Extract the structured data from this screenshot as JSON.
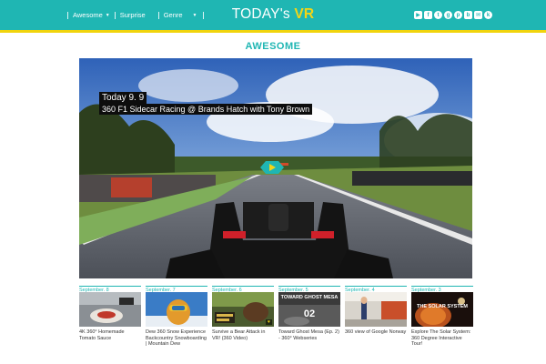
{
  "header": {
    "nav": [
      {
        "label": "Awesome",
        "dropdown": true
      },
      {
        "label": "Surprise",
        "dropdown": false
      },
      {
        "label": "Genre",
        "dropdown": true
      }
    ],
    "brand_part1": "TODAY's",
    "brand_part2": "VR",
    "socials": [
      "youtube-icon",
      "facebook-icon",
      "twitter-icon",
      "google-plus-icon",
      "pinterest-icon",
      "blog-icon",
      "mail-icon",
      "kakao-icon"
    ],
    "colors": {
      "bar": "#1fb6b3",
      "stripe": "#f1d40d",
      "accent": "#f3d516"
    }
  },
  "section": {
    "title": "AWESOME"
  },
  "featured": {
    "date": "Today 9. 9",
    "title": "360 F1 Sidecar Racing @ Brands Hatch with Tony Brown"
  },
  "thumbnails": [
    {
      "date": "September. 8",
      "caption": "4K 360° Homemade Tomato Sauce"
    },
    {
      "date": "September. 7",
      "caption": "Dew 360 Snow Experience Backcountry Snowboarding | Mountain Dew"
    },
    {
      "date": "September. 6",
      "caption": "Survive a Bear Attack in VR! (360 Video)"
    },
    {
      "date": "September. 5",
      "caption": "Toward Ghost Mesa (Ep. 2) - 360° Webseries",
      "overlay": "TOWARD GHOST MESA",
      "overlay_num": "02"
    },
    {
      "date": "September. 4",
      "caption": "360 view of Google Norway"
    },
    {
      "date": "September. 3",
      "caption": "Explore The Solar System: 360 Degree Interactive Tour!",
      "overlay": "THE SOLAR SYSTEM"
    }
  ]
}
